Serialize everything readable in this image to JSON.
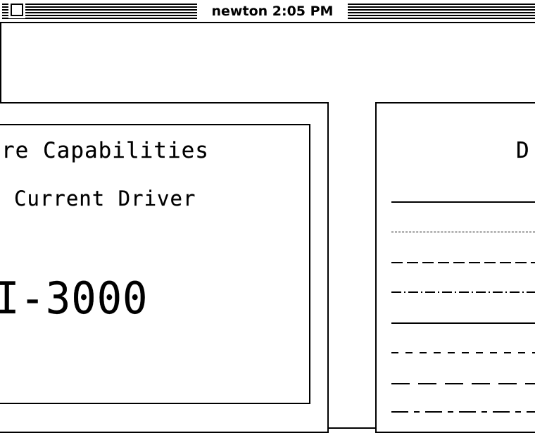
{
  "titlebar": {
    "title": "newton 2:05 PM"
  },
  "left_panel": {
    "capabilities_text": "re Capabilities",
    "driver_text": "Current Driver",
    "model_text": "I-3000"
  },
  "right_panel": {
    "title_fragment": "D",
    "line_types": [
      "solid",
      "dense-dashed",
      "dashed",
      "dash-dot",
      "solid",
      "dashed-spaced",
      "long-dash",
      "long-dash-dot"
    ]
  }
}
